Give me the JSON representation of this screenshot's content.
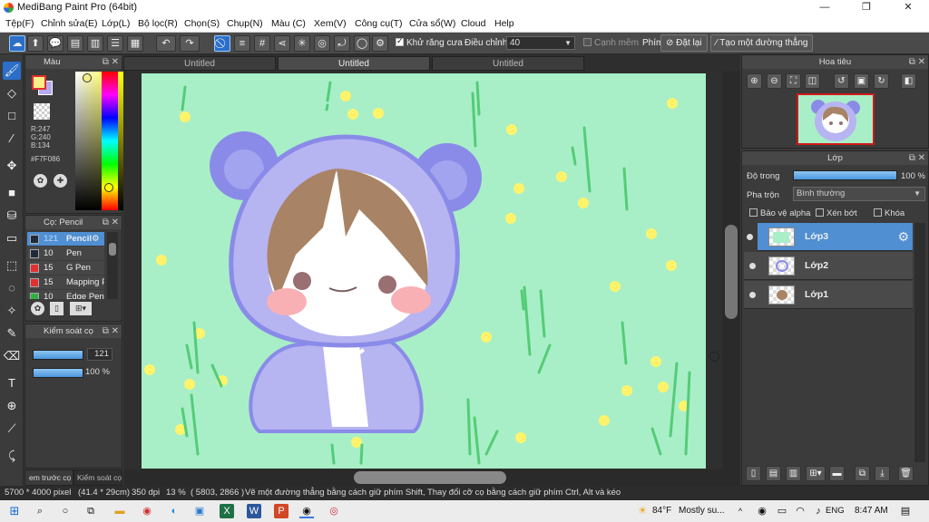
{
  "window": {
    "title": "MediBang Paint Pro (64bit)",
    "minimize": "—",
    "maximize": "❐",
    "close": "✕"
  },
  "menu": [
    "Tệp(F)",
    "Chỉnh sửa(E)",
    "Lớp(L)",
    "Bộ lọc(R)",
    "Chọn(S)",
    "Chụp(N)",
    "Màu (C)",
    "Xem(V)",
    "Công cụ(T)",
    "Cửa sổ(W)",
    "Cloud",
    "Help"
  ],
  "toolbar": {
    "antialias_label": "Khử răng cưa",
    "antialias_checked": true,
    "adjust_label": "Điều chỉnh",
    "adjust_value": "40",
    "soft_edge_label": "Cạnh mềm",
    "key_label": "Phím",
    "reset_label": "Đặt lại",
    "straight_line_label": "Tạo một đường thẳng"
  },
  "doc_tabs": [
    "Untitled",
    "Untitled",
    "Untitled"
  ],
  "color_panel": {
    "title": "Màu",
    "r": "R:247",
    "g": "G:240",
    "b": "B:134",
    "hex": "#F7F086",
    "fg_color": "#F7F086",
    "bg_color": "#b7a9ee"
  },
  "brush_panel": {
    "title": "Cọ: Pencil",
    "items": [
      {
        "size": "121",
        "name": "Pencil",
        "color": "#1f2a3a"
      },
      {
        "size": "10",
        "name": "Pen",
        "color": "#1f2a3a"
      },
      {
        "size": "15",
        "name": "G Pen",
        "color": "#e03030"
      },
      {
        "size": "15",
        "name": "Mapping Pen",
        "color": "#e03030"
      },
      {
        "size": "10",
        "name": "Edge Pen",
        "color": "#30b040"
      }
    ]
  },
  "brush_control": {
    "title": "Kiểm soát cọ",
    "size_value": "121",
    "opacity_value": "100 %"
  },
  "left_bottom_tabs": [
    "em trước cọ",
    "Kiểm soát cọ"
  ],
  "navigator": {
    "title": "Hoa tiêu"
  },
  "layer_panel": {
    "title": "Lớp",
    "opacity_label": "Độ trong",
    "opacity_value": "100 %",
    "blend_label": "Pha trộn",
    "blend_value": "Bình thường",
    "protect_alpha": "Bảo vệ alpha",
    "clipping": "Xén bớt",
    "lock": "Khóa",
    "layers": [
      {
        "name": "Lớp3",
        "active": true
      },
      {
        "name": "Lớp2",
        "active": false
      },
      {
        "name": "Lớp1",
        "active": false
      }
    ]
  },
  "status": {
    "size": "5700 * 4000 pixel",
    "cm": "(41.4 * 29cm)",
    "dpi": "350 dpi",
    "zoom": "13 %",
    "coords": "( 5803, 2866 )",
    "hint": "Vẽ một đường thẳng bằng cách giữ phím Shift, Thay đổi cỡ cọ bằng cách giữ phím Ctrl, Alt và kéo"
  },
  "taskbar": {
    "weather_temp": "84°F",
    "weather_text": "Mostly su...",
    "lang": "ENG",
    "time": "8:47 AM"
  }
}
